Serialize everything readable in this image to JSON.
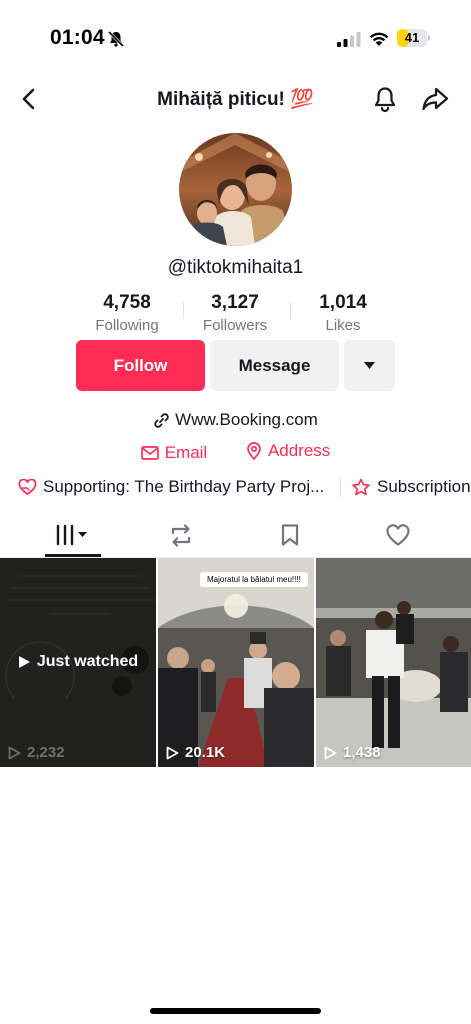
{
  "status_bar": {
    "time": "01:04",
    "battery": "41",
    "battery_percent": 41
  },
  "header": {
    "title": "Mihăiță piticu! 💯"
  },
  "profile": {
    "username": "@tiktokmihaita1",
    "stats": [
      {
        "value": "4,758",
        "label": "Following"
      },
      {
        "value": "3,127",
        "label": "Followers"
      },
      {
        "value": "1,014",
        "label": "Likes"
      }
    ],
    "follow_label": "Follow",
    "message_label": "Message",
    "website": "Www.Booking.com",
    "email_label": "Email",
    "address_label": "Address",
    "supporting_label": "Supporting: The Birthday Party Proj...",
    "subscription_label": "Subscription"
  },
  "tabs": [
    {
      "name": "videos",
      "icon": "grid-icon"
    },
    {
      "name": "reposts",
      "icon": "repost-icon"
    },
    {
      "name": "favorites",
      "icon": "bookmark-icon"
    },
    {
      "name": "liked",
      "icon": "heart-icon"
    }
  ],
  "videos": [
    {
      "views": "2,232",
      "overlay": "Just watched"
    },
    {
      "views": "20.1K",
      "caption": "Majoratul la băiatul meu!!!!"
    },
    {
      "views": "1,438"
    }
  ],
  "colors": {
    "accent": "#fe2c55",
    "text": "#161823",
    "muted": "#75767d"
  }
}
